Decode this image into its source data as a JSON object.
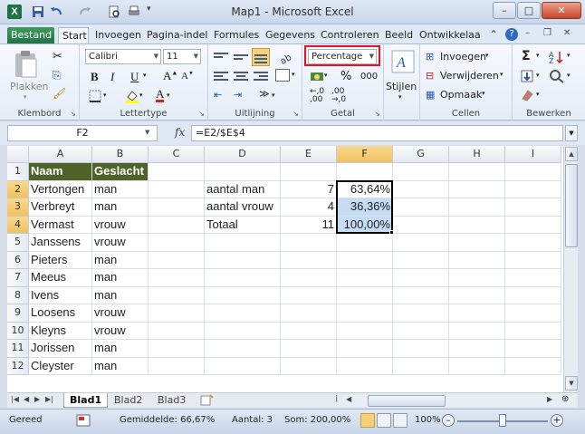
{
  "window": {
    "title": "Map1 - Microsoft Excel",
    "app_icon": "X"
  },
  "colors": {
    "header_fill": "#4f6228",
    "selection_fill": "#c6dbf4",
    "file_tab": "#1e7145",
    "highlight_box": "#e81123"
  },
  "tabs": [
    "Bestand",
    "Start",
    "Invoegen",
    "Pagina-indel",
    "Formules",
    "Gegevens",
    "Controleren",
    "Beeld",
    "Ontwikkelaa"
  ],
  "ribbon": {
    "clipboard": {
      "paste_label": "Plakken",
      "group_label": "Klembord"
    },
    "font": {
      "font_name": "Calibri",
      "font_size": "11",
      "group_label": "Lettertype",
      "bold": "B",
      "italic": "I",
      "underline": "U"
    },
    "alignment": {
      "group_label": "Uitlijning"
    },
    "number": {
      "format": "Percentage",
      "percent": "%",
      "thousands": "000",
      "group_label": "Getal"
    },
    "styles": {
      "label": "Stijlen"
    },
    "cells": {
      "insert": "Invoegen",
      "delete": "Verwijderen",
      "format": "Opmaak",
      "group_label": "Cellen"
    },
    "editing": {
      "group_label": "Bewerken"
    }
  },
  "formula_bar": {
    "name_box": "F2",
    "fx": "fx",
    "formula": "=E2/$E$4"
  },
  "sheet": {
    "columns": [
      "A",
      "B",
      "C",
      "D",
      "E",
      "F",
      "G",
      "H",
      "I"
    ],
    "rows": [
      "1",
      "2",
      "3",
      "4",
      "5",
      "6",
      "7",
      "8",
      "9",
      "10",
      "11",
      "12"
    ],
    "data": [
      [
        "Naam",
        "Geslacht",
        "",
        "",
        "",
        "",
        "",
        "",
        ""
      ],
      [
        "Vertongen",
        "man",
        "",
        "aantal man",
        "7",
        "63,64%",
        "",
        "",
        ""
      ],
      [
        "Verbreyt",
        "man",
        "",
        "aantal vrouw",
        "4",
        "36,36%",
        "",
        "",
        ""
      ],
      [
        "Vermast",
        "vrouw",
        "",
        "Totaal",
        "11",
        "100,00%",
        "",
        "",
        ""
      ],
      [
        "Janssens",
        "vrouw",
        "",
        "",
        "",
        "",
        "",
        "",
        ""
      ],
      [
        "Pieters",
        "man",
        "",
        "",
        "",
        "",
        "",
        "",
        ""
      ],
      [
        "Meeus",
        "man",
        "",
        "",
        "",
        "",
        "",
        "",
        ""
      ],
      [
        "Ivens",
        "man",
        "",
        "",
        "",
        "",
        "",
        "",
        ""
      ],
      [
        "Loosens",
        "vrouw",
        "",
        "",
        "",
        "",
        "",
        "",
        ""
      ],
      [
        "Kleyns",
        "vrouw",
        "",
        "",
        "",
        "",
        "",
        "",
        ""
      ],
      [
        "Jorissen",
        "man",
        "",
        "",
        "",
        "",
        "",
        "",
        ""
      ],
      [
        "Cleyster",
        "man",
        "",
        "",
        "",
        "",
        "",
        "",
        ""
      ]
    ],
    "tabs": [
      "Blad1",
      "Blad2",
      "Blad3"
    ]
  },
  "status": {
    "ready": "Gereed",
    "average": "Gemiddelde: 66,67%",
    "count": "Aantal: 3",
    "sum": "Som: 200,00%",
    "zoom": "100%",
    "zoom_level": 0.5
  }
}
